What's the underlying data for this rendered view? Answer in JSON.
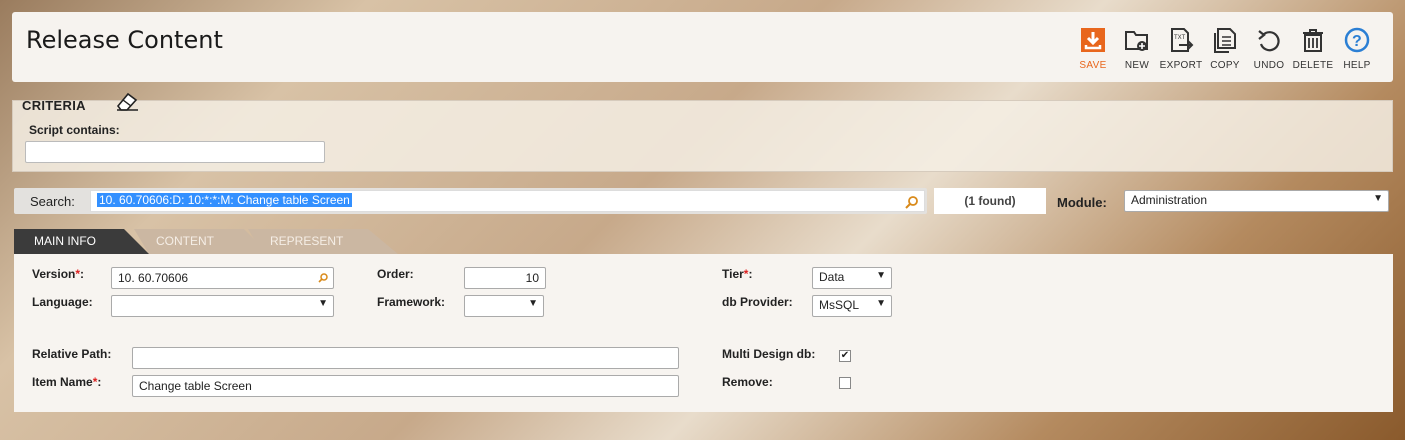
{
  "header": {
    "title": "Release Content",
    "toolbar": [
      {
        "label": "SAVE",
        "icon": "save-icon"
      },
      {
        "label": "NEW",
        "icon": "new-folder-icon"
      },
      {
        "label": "EXPORT",
        "icon": "export-icon"
      },
      {
        "label": "COPY",
        "icon": "copy-icon"
      },
      {
        "label": "UNDO",
        "icon": "undo-icon"
      },
      {
        "label": "DELETE",
        "icon": "trash-icon"
      },
      {
        "label": "HELP",
        "icon": "help-icon"
      }
    ]
  },
  "criteria": {
    "title": "CRITERIA",
    "script_label": "Script contains:",
    "script_value": ""
  },
  "search": {
    "label": "Search:",
    "value": "10.  60.70606:D:   10:*:*:M: Change table Screen",
    "found": "(1 found)",
    "module_label": "Module:",
    "module_value": "Administration"
  },
  "tabs": [
    {
      "label": "MAIN INFO",
      "active": true
    },
    {
      "label": "CONTENT",
      "active": false
    },
    {
      "label": "REPRESENT",
      "active": false
    }
  ],
  "form": {
    "version_label": "Version",
    "version_value": "10.  60.70606",
    "language_label": "Language:",
    "language_value": "",
    "order_label": "Order:",
    "order_value": "10",
    "framework_label": "Framework:",
    "framework_value": "",
    "tier_label": "Tier",
    "tier_value": "Data",
    "dbprovider_label": "db Provider:",
    "dbprovider_value": "MsSQL",
    "relpath_label": "Relative Path:",
    "relpath_value": "",
    "itemname_label": "Item Name",
    "itemname_value": "Change table Screen",
    "multidesign_label": "Multi Design db:",
    "multidesign_checked": true,
    "remove_label": "Remove:",
    "remove_checked": false
  },
  "colors": {
    "save_accent": "#e8661c",
    "help_accent": "#2b7fd4",
    "active_tab": "#3b3b3b",
    "inactive_tab": "#cbb7a2",
    "selection": "#3390ff"
  }
}
